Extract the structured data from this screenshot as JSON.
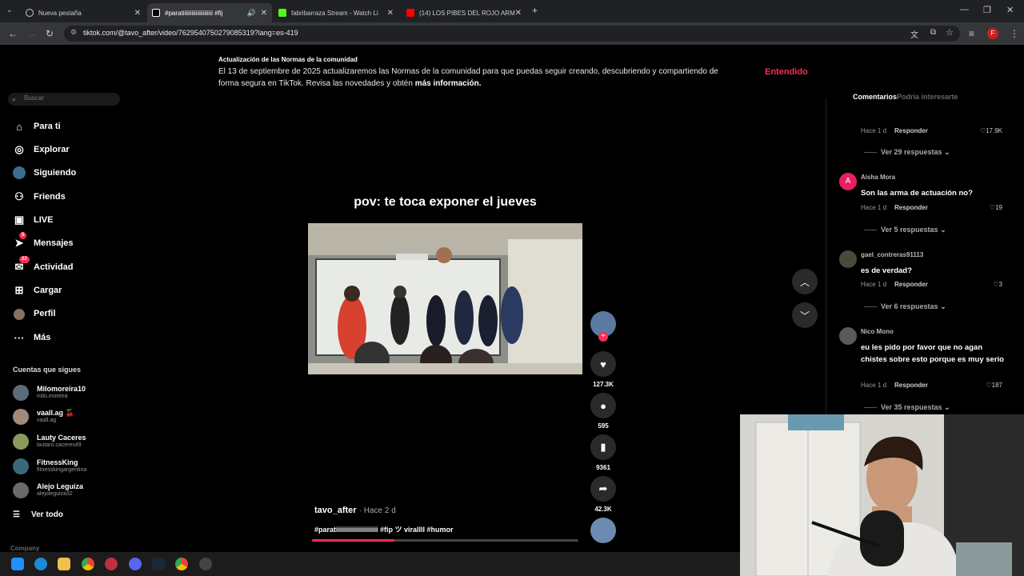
{
  "browser": {
    "tabs": [
      {
        "title": "Nueva pestaña",
        "active": false
      },
      {
        "title": "#paratiiiiiiiiiiiiiiiiiiiii #fij",
        "active": true
      },
      {
        "title": "fabribarraza Stream - Watch Li",
        "active": false
      },
      {
        "title": "(14) LOS PIBES DEL ROJO ARM",
        "active": false
      }
    ],
    "url": "tiktok.com/@tavo_after/video/7629540750279085319?lang=es-419",
    "profile_initial": "F"
  },
  "notice": {
    "title": "Actualización de las Normas de la comunidad",
    "body": "El 13 de septiembre de 2025 actualizaremos las Normas de la comunidad para que puedas seguir creando, descubriendo y compartiendo de forma segura en TikTok. Revisa las novedades y obtén",
    "link": "más información.",
    "button": "Entendido"
  },
  "sidebar": {
    "search_placeholder": "Buscar",
    "items": [
      {
        "label": "Para ti",
        "icon": "home-icon"
      },
      {
        "label": "Explorar",
        "icon": "compass-icon"
      },
      {
        "label": "Siguiendo",
        "icon": "following-icon"
      },
      {
        "label": "Friends",
        "icon": "friends-icon"
      },
      {
        "label": "LIVE",
        "icon": "live-icon"
      },
      {
        "label": "Mensajes",
        "icon": "messages-icon",
        "badge": "5"
      },
      {
        "label": "Actividad",
        "icon": "activity-icon",
        "badge": "22"
      },
      {
        "label": "Cargar",
        "icon": "upload-icon"
      },
      {
        "label": "Perfil",
        "icon": "profile-icon"
      },
      {
        "label": "Más",
        "icon": "more-icon"
      }
    ],
    "following_header": "Cuentas que sigues",
    "following": [
      {
        "name": "Milomoreira10",
        "handle": "milo.moreira"
      },
      {
        "name": "vaall.ag 🍒",
        "handle": "vaall.ag"
      },
      {
        "name": "Lauty Caceres",
        "handle": "lautaro.caceres49"
      },
      {
        "name": "FitnessKing",
        "handle": "fitnesskingargentina"
      },
      {
        "name": "Alejo Leguiza",
        "handle": "alejoleguiza32"
      }
    ],
    "see_all": "Ver todo",
    "footer": "Company"
  },
  "video": {
    "caption": "pov: te toca exponer el jueves",
    "author": "tavo_after",
    "posted": "· Hace 2 d",
    "tags": "#paratiiiiiiiiiiiiiiiiiiiii #fip ツ virallll #humor",
    "progress": 0.31,
    "likes": "127.3K",
    "comments": "595",
    "saves": "9361",
    "shares": "42.3K"
  },
  "comments": {
    "tab_active": "Comentarios",
    "tab_inactive": "Podría interesarte",
    "top": {
      "meta": "Hace 1 d",
      "reply": "Responder",
      "likes": "17.9K",
      "replies": "Ver 29 respuestas"
    },
    "list": [
      {
        "user": "Aisha Mora",
        "initial": "A",
        "text": "Son las arma de actuación no?",
        "meta": "Hace 1 d",
        "reply": "Responder",
        "likes": "19",
        "replies": "Ver 5 respuestas"
      },
      {
        "user": "gael_contreras91113",
        "text": "es de verdad?",
        "meta": "Hace 1 d",
        "reply": "Responder",
        "likes": "3",
        "replies": "Ver 6 respuestas"
      },
      {
        "user": "Nico Mono",
        "text": "eu les pido por favor que no agan chistes sobre esto porque es muy serio",
        "meta": "Hace 1 d",
        "reply": "Responder",
        "likes": "187",
        "replies": "Ver 35 respuestas"
      }
    ]
  },
  "colors": {
    "accent": "#fe2c55",
    "background": "#000000",
    "chrome": "#202124"
  }
}
